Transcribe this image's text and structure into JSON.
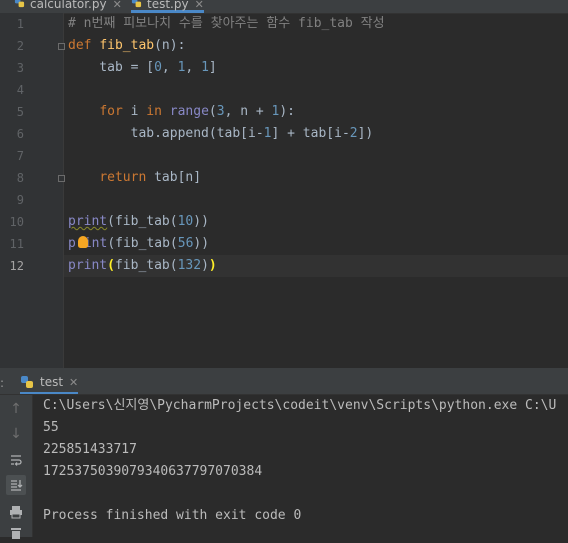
{
  "editor_tabs": [
    {
      "label": "calculator.py",
      "active": false
    },
    {
      "label": "test.py",
      "active": true
    }
  ],
  "line_numbers": [
    "1",
    "2",
    "3",
    "4",
    "5",
    "6",
    "7",
    "8",
    "9",
    "10",
    "11",
    "12"
  ],
  "current_line": "12",
  "code": {
    "line1_comment": "# n번째 피보나치 수를 찾아주는 함수 fib_tab 작성",
    "line2_def": "def",
    "line2_fn": "fib_tab",
    "line2_rest": "(n):",
    "line3_a": "    tab = [",
    "line3_n1": "0",
    "line3_c1": ", ",
    "line3_n2": "1",
    "line3_c2": ", ",
    "line3_n3": "1",
    "line3_b": "]",
    "line5_indent": "    ",
    "line5_for": "for",
    "line5_i": " i ",
    "line5_in": "in",
    "line5_sp": " ",
    "line5_range": "range",
    "line5_o": "(",
    "line5_n3": "3",
    "line5_mid": ", n + ",
    "line5_n1": "1",
    "line5_end": "):",
    "line6_a": "        tab.append(tab[i-",
    "line6_n1": "1",
    "line6_b": "] + tab[i-",
    "line6_n2": "2",
    "line6_c": "])",
    "line8_indent": "    ",
    "line8_return": "return",
    "line8_rest": " tab[n]",
    "line10_print": "print",
    "line10_a": "(fib_tab(",
    "line10_n": "10",
    "line10_b": "))",
    "line11_p": "p",
    "line11_rint": "int",
    "line11_a": "(fib_tab(",
    "line11_n": "56",
    "line11_b": "))",
    "line12_print": "print",
    "line12_open": "(",
    "line12_a": "fib_tab(",
    "line12_n": "132",
    "line12_b": ")",
    "line12_close": ")"
  },
  "run_panel": {
    "cut_label": ":",
    "tab_label": "test"
  },
  "run_toolbar_icons": [
    "up-arrow-icon",
    "down-arrow-icon",
    "soft-wrap-icon",
    "scroll-to-end-icon",
    "print-icon",
    "delete-icon"
  ],
  "console_lines": [
    "C:\\Users\\신지영\\PycharmProjects\\codeit\\venv\\Scripts\\python.exe C:\\U",
    "55",
    "225851433717",
    "1725375039079340637797070384",
    "",
    "Process finished with exit code 0"
  ],
  "colors": {
    "background": "#2b2b2b",
    "keyword": "#cc7832",
    "function_name": "#ffc66d",
    "number": "#6897bb",
    "builtin": "#8888c6",
    "comment": "#808080",
    "text": "#a9b7c6",
    "active_tab_underline": "#4a88c7"
  }
}
